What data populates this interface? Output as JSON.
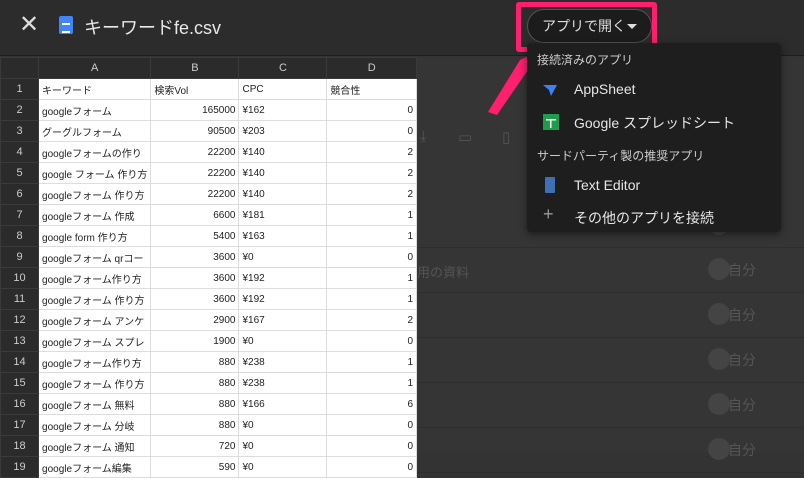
{
  "header": {
    "title": "キーワードfe.csv",
    "open_with_label": "アプリで開く"
  },
  "menu": {
    "section_connected": "接続済みのアプリ",
    "section_third_party": "サードパーティ製の推奨アプリ",
    "items": [
      {
        "label": "AppSheet"
      },
      {
        "label": "Google スプレッドシート"
      },
      {
        "label": "Text Editor"
      },
      {
        "label": "その他のアプリを接続"
      }
    ]
  },
  "background": {
    "text": "用の資料",
    "owner": "自分"
  },
  "sheet": {
    "columns": [
      "A",
      "B",
      "C",
      "D"
    ],
    "rows": [
      [
        "キーワード",
        "検索Vol",
        "CPC",
        "競合性"
      ],
      [
        "googleフォーム",
        "165000",
        "¥162",
        "0"
      ],
      [
        "グーグルフォーム",
        "90500",
        "¥203",
        "0"
      ],
      [
        "googleフォームの作り",
        "22200",
        "¥140",
        "2"
      ],
      [
        "google フォーム 作り方",
        "22200",
        "¥140",
        "2"
      ],
      [
        "googleフォーム 作り方",
        "22200",
        "¥140",
        "2"
      ],
      [
        "googleフォーム 作成",
        "6600",
        "¥181",
        "1"
      ],
      [
        "google form 作り方",
        "5400",
        "¥163",
        "1"
      ],
      [
        "googleフォーム qrコー",
        "3600",
        "¥0",
        "0"
      ],
      [
        "googleフォーム作り方",
        "3600",
        "¥192",
        "1"
      ],
      [
        "googleフォーム 作り方",
        "3600",
        "¥192",
        "1"
      ],
      [
        "googleフォーム アンケ",
        "2900",
        "¥167",
        "2"
      ],
      [
        "googleフォーム スプレ",
        "1900",
        "¥0",
        "0"
      ],
      [
        "googleフォーム作り方",
        "880",
        "¥238",
        "1"
      ],
      [
        "googleフォーム 作り方",
        "880",
        "¥238",
        "1"
      ],
      [
        "googleフォーム 無料",
        "880",
        "¥166",
        "6"
      ],
      [
        "googleフォーム 分岐",
        "880",
        "¥0",
        "0"
      ],
      [
        "googleフォーム 通知",
        "720",
        "¥0",
        "0"
      ],
      [
        "googleフォーム編集",
        "590",
        "¥0",
        "0"
      ]
    ]
  }
}
